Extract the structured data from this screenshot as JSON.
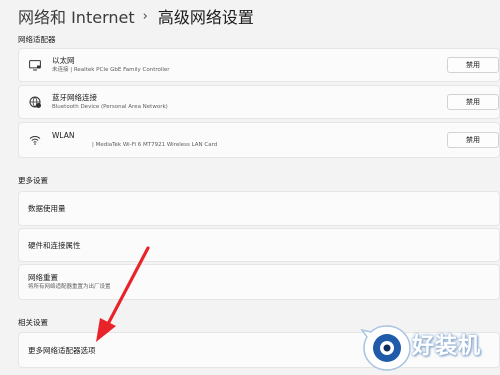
{
  "breadcrumb": {
    "parent": "网络和 Internet",
    "separator": "›",
    "current": "高级网络设置"
  },
  "sections": {
    "adapters_label": "网络适配器",
    "more_label": "更多设置",
    "related_label": "相关设置"
  },
  "adapters": [
    {
      "title": "以太网",
      "subtitle": "未连接 | Realtek PCIe GbE Family Controller",
      "button": "禁用",
      "icon": "ethernet-icon"
    },
    {
      "title": "蓝牙网络连接",
      "subtitle": "Bluetooth Device (Personal Area Network)",
      "button": "禁用",
      "icon": "bluetooth-network-icon"
    },
    {
      "title": "WLAN",
      "subtitle": "| MediaTek Wi-Fi 6 MT7921 Wireless LAN Card",
      "button": "禁用",
      "icon": "wifi-icon"
    }
  ],
  "more_settings": [
    {
      "title": "数据使用量"
    },
    {
      "title": "硬件和连接属性"
    },
    {
      "title": "网络重置",
      "subtitle": "将所有网络适配器重置为出厂设置"
    }
  ],
  "related_settings": [
    {
      "title": "更多网络适配器选项"
    }
  ],
  "colors": {
    "arrow": "#e8232a",
    "background": "#f3f3f3",
    "card": "#fbfbfb"
  },
  "watermark": {
    "text": "好装机",
    "icon": "eye-logo-icon"
  }
}
